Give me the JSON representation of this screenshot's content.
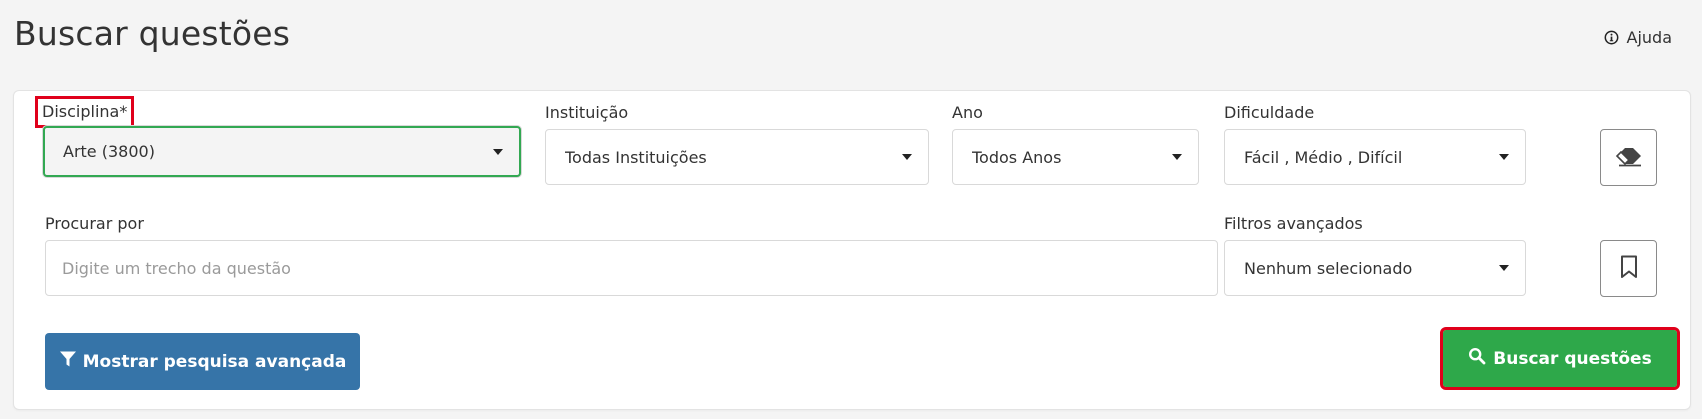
{
  "header": {
    "title": "Buscar questões",
    "help_label": "Ajuda",
    "help_icon": "info-circle-icon"
  },
  "filters": {
    "disciplina": {
      "label": "Disciplina*",
      "value": "Arte (3800)"
    },
    "instituicao": {
      "label": "Instituição",
      "value": "Todas Instituições"
    },
    "ano": {
      "label": "Ano",
      "value": "Todos Anos"
    },
    "dificuldade": {
      "label": "Dificuldade",
      "value": "Fácil , Médio , Difícil"
    },
    "procurar": {
      "label": "Procurar por",
      "placeholder": "Digite um trecho da questão",
      "value": ""
    },
    "filtros_avancados": {
      "label": "Filtros avançados",
      "value": "Nenhum selecionado"
    }
  },
  "actions": {
    "clear_icon": "eraser-icon",
    "bookmark_icon": "bookmark-icon",
    "advanced_label": "Mostrar pesquisa avançada",
    "advanced_icon": "filter-icon",
    "search_label": "Buscar questões",
    "search_icon": "search-icon"
  },
  "colors": {
    "primary_blue": "#3674a8",
    "success_green": "#2ea84a",
    "highlight_red": "#e0001b",
    "background": "#f4f4f4"
  }
}
